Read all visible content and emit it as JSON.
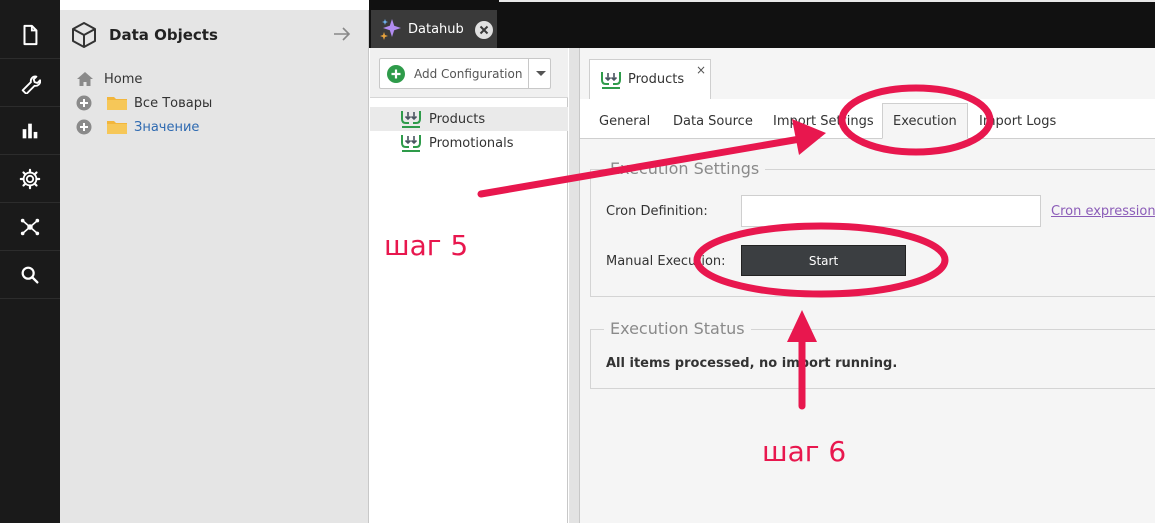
{
  "rail": {
    "items": [
      {
        "icon": "document-icon"
      },
      {
        "icon": "wrench-icon"
      },
      {
        "icon": "bar-chart-icon"
      },
      {
        "icon": "gear-icon"
      },
      {
        "icon": "network-icon"
      },
      {
        "icon": "search-icon"
      }
    ]
  },
  "objects_panel": {
    "title": "Data Objects",
    "tree": [
      {
        "label": "Home"
      },
      {
        "label": "Все Товары"
      },
      {
        "label": "Значение"
      }
    ]
  },
  "top_tab": {
    "label": "Datahub"
  },
  "config_panel": {
    "add_label": "Add Configuration",
    "items": [
      {
        "label": "Products"
      },
      {
        "label": "Promotionals"
      }
    ]
  },
  "editor": {
    "tab_label": "Products",
    "tab_close": "×",
    "subtabs": [
      "General",
      "Data Source",
      "Import Settings",
      "Execution",
      "Import Logs"
    ],
    "active_subtab": "Execution",
    "execution_settings": {
      "legend": "Execution Settings",
      "cron_label": "Cron Definition:",
      "cron_value": "",
      "cron_link": "Cron expression g",
      "manual_label": "Manual Execution:",
      "start_label": "Start"
    },
    "execution_status": {
      "legend": "Execution Status",
      "text": "All items processed, no import running."
    }
  },
  "annotations": {
    "step5": "шаг 5",
    "step6": "шаг 6",
    "color": "#e8174e"
  }
}
